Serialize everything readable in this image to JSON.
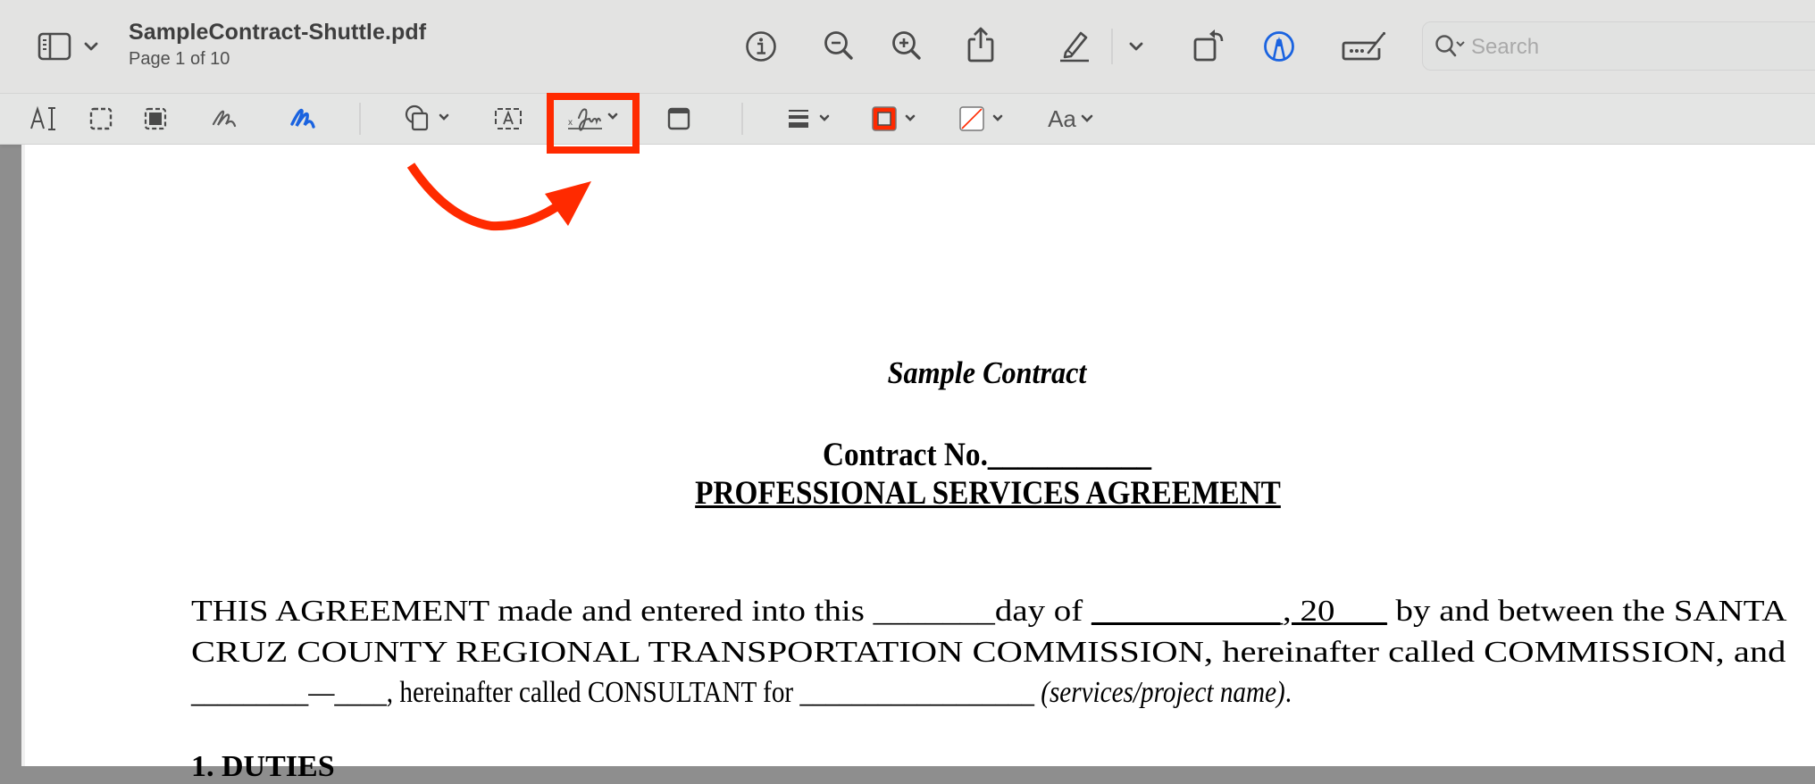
{
  "window": {
    "filename": "SampleContract-Shuttle.pdf",
    "page_status": "Page 1 of 10"
  },
  "toolbar": {
    "buttons": [
      {
        "name": "sidebar-toggle",
        "icon": "sidebar-icon"
      },
      {
        "name": "info",
        "icon": "info-icon"
      },
      {
        "name": "zoom-out",
        "icon": "zoom-out-icon"
      },
      {
        "name": "zoom-in",
        "icon": "zoom-in-icon"
      },
      {
        "name": "share",
        "icon": "share-icon"
      },
      {
        "name": "highlight",
        "icon": "highlighter-pencil-icon"
      },
      {
        "name": "rotate",
        "icon": "rotate-left-icon"
      },
      {
        "name": "markup",
        "icon": "markup-pen-circle-icon",
        "active": true
      },
      {
        "name": "form-filling",
        "icon": "form-fill-icon"
      }
    ],
    "search": {
      "placeholder": "Search",
      "value": ""
    }
  },
  "markup_toolbar": {
    "tools": [
      {
        "name": "text-selection",
        "icon": "text-selection-icon"
      },
      {
        "name": "rectangular-selection",
        "icon": "rect-selection-icon"
      },
      {
        "name": "redact",
        "icon": "redact-icon"
      },
      {
        "name": "sketch",
        "icon": "sketch-icon"
      },
      {
        "name": "draw",
        "icon": "draw-icon",
        "active": true
      },
      {
        "name": "shapes",
        "icon": "shapes-icon",
        "has_menu": true
      },
      {
        "name": "text-box",
        "icon": "text-box-icon"
      },
      {
        "name": "sign",
        "icon": "signature-icon",
        "has_menu": true,
        "highlighted": true
      },
      {
        "name": "note",
        "icon": "note-icon"
      },
      {
        "name": "shape-style",
        "icon": "line-style-icon",
        "has_menu": true
      },
      {
        "name": "border-color",
        "icon": "border-color-icon",
        "has_menu": true
      },
      {
        "name": "fill-color",
        "icon": "fill-color-icon",
        "has_menu": true
      },
      {
        "name": "text-style",
        "label": "Aa",
        "has_menu": true
      }
    ]
  },
  "colors": {
    "accent_blue": "#1a63e0",
    "annotation_red": "#ff2a00",
    "border_color_swatch": "#ff2a00"
  },
  "document": {
    "title": "Sample Contract",
    "contract_no_label": "Contract No.",
    "contract_no_blank": "___________",
    "heading": "PROFESSIONAL SERVICES AGREEMENT",
    "para1": {
      "line1_a": "THIS AGREEMENT made and entered into this ",
      "line1_blank1": "_______",
      "line1_b": "day of ",
      "line1_blank2": "___________, 20___",
      "line1_c": " by and between the SANTA",
      "line2": "CRUZ COUNTY REGIONAL TRANSPORTATION COMMISSION, hereinafter called COMMISSION, and",
      "line3_blank1": "_________—____",
      "line3_a": ", hereinafter called CONSULTANT for ",
      "line3_blank2": "__________________",
      "line3_italic": " (services/project name)",
      "line3_end": "."
    },
    "section1": "1.    DUTIES"
  }
}
